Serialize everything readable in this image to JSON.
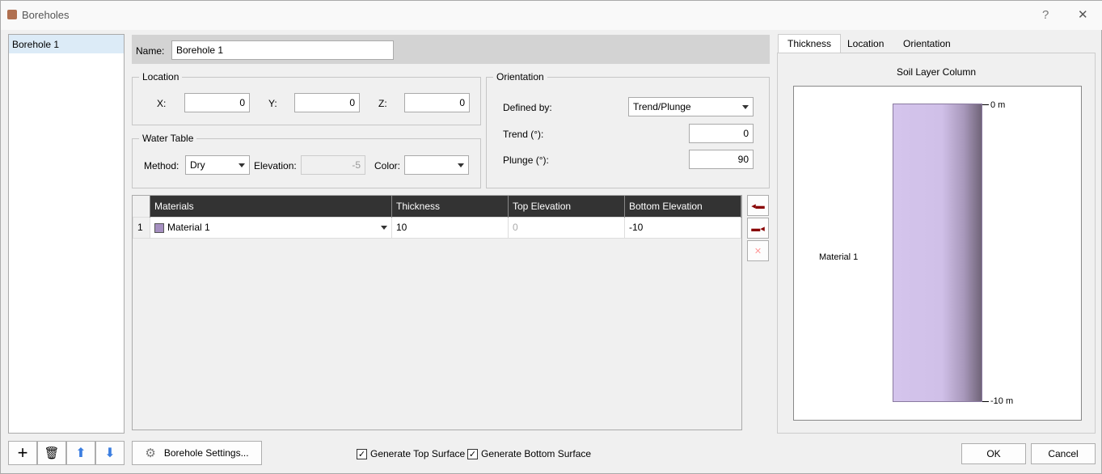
{
  "window": {
    "title": "Boreholes",
    "help": "?",
    "close": "✕"
  },
  "boreholes": [
    {
      "label": "Borehole 1"
    }
  ],
  "name": {
    "label": "Name:",
    "value": "Borehole 1"
  },
  "location": {
    "title": "Location",
    "x_label": "X:",
    "x": "0",
    "y_label": "Y:",
    "y": "0",
    "z_label": "Z:",
    "z": "0"
  },
  "water_table": {
    "title": "Water Table",
    "method_label": "Method:",
    "method": "Dry",
    "elevation_label": "Elevation:",
    "elevation": "-5",
    "color_label": "Color:",
    "color": ""
  },
  "orientation": {
    "title": "Orientation",
    "defined_by_label": "Defined by:",
    "defined_by": "Trend/Plunge",
    "trend_label": "Trend (°):",
    "trend": "0",
    "plunge_label": "Plunge (°):",
    "plunge": "90"
  },
  "table": {
    "columns": [
      "Materials",
      "Thickness",
      "Top Elevation",
      "Bottom Elevation"
    ],
    "rows": [
      {
        "index": "1",
        "material": "Material 1",
        "material_color": "#a58fc0",
        "thickness": "10",
        "top": "0",
        "bottom": "-10"
      }
    ]
  },
  "tabs": [
    {
      "label": "Thickness",
      "active": true
    },
    {
      "label": "Location"
    },
    {
      "label": "Orientation"
    }
  ],
  "soil_column": {
    "title": "Soil Layer Column",
    "top_label": "0 m",
    "bottom_label": "-10 m",
    "material_label": "Material 1",
    "color": "#d4c4ec"
  },
  "bottom": {
    "settings_label": "Borehole Settings...",
    "gen_top": "Generate Top Surface",
    "gen_top_checked": true,
    "gen_bottom": "Generate Bottom Surface",
    "gen_bottom_checked": true,
    "ok": "OK",
    "cancel": "Cancel"
  }
}
